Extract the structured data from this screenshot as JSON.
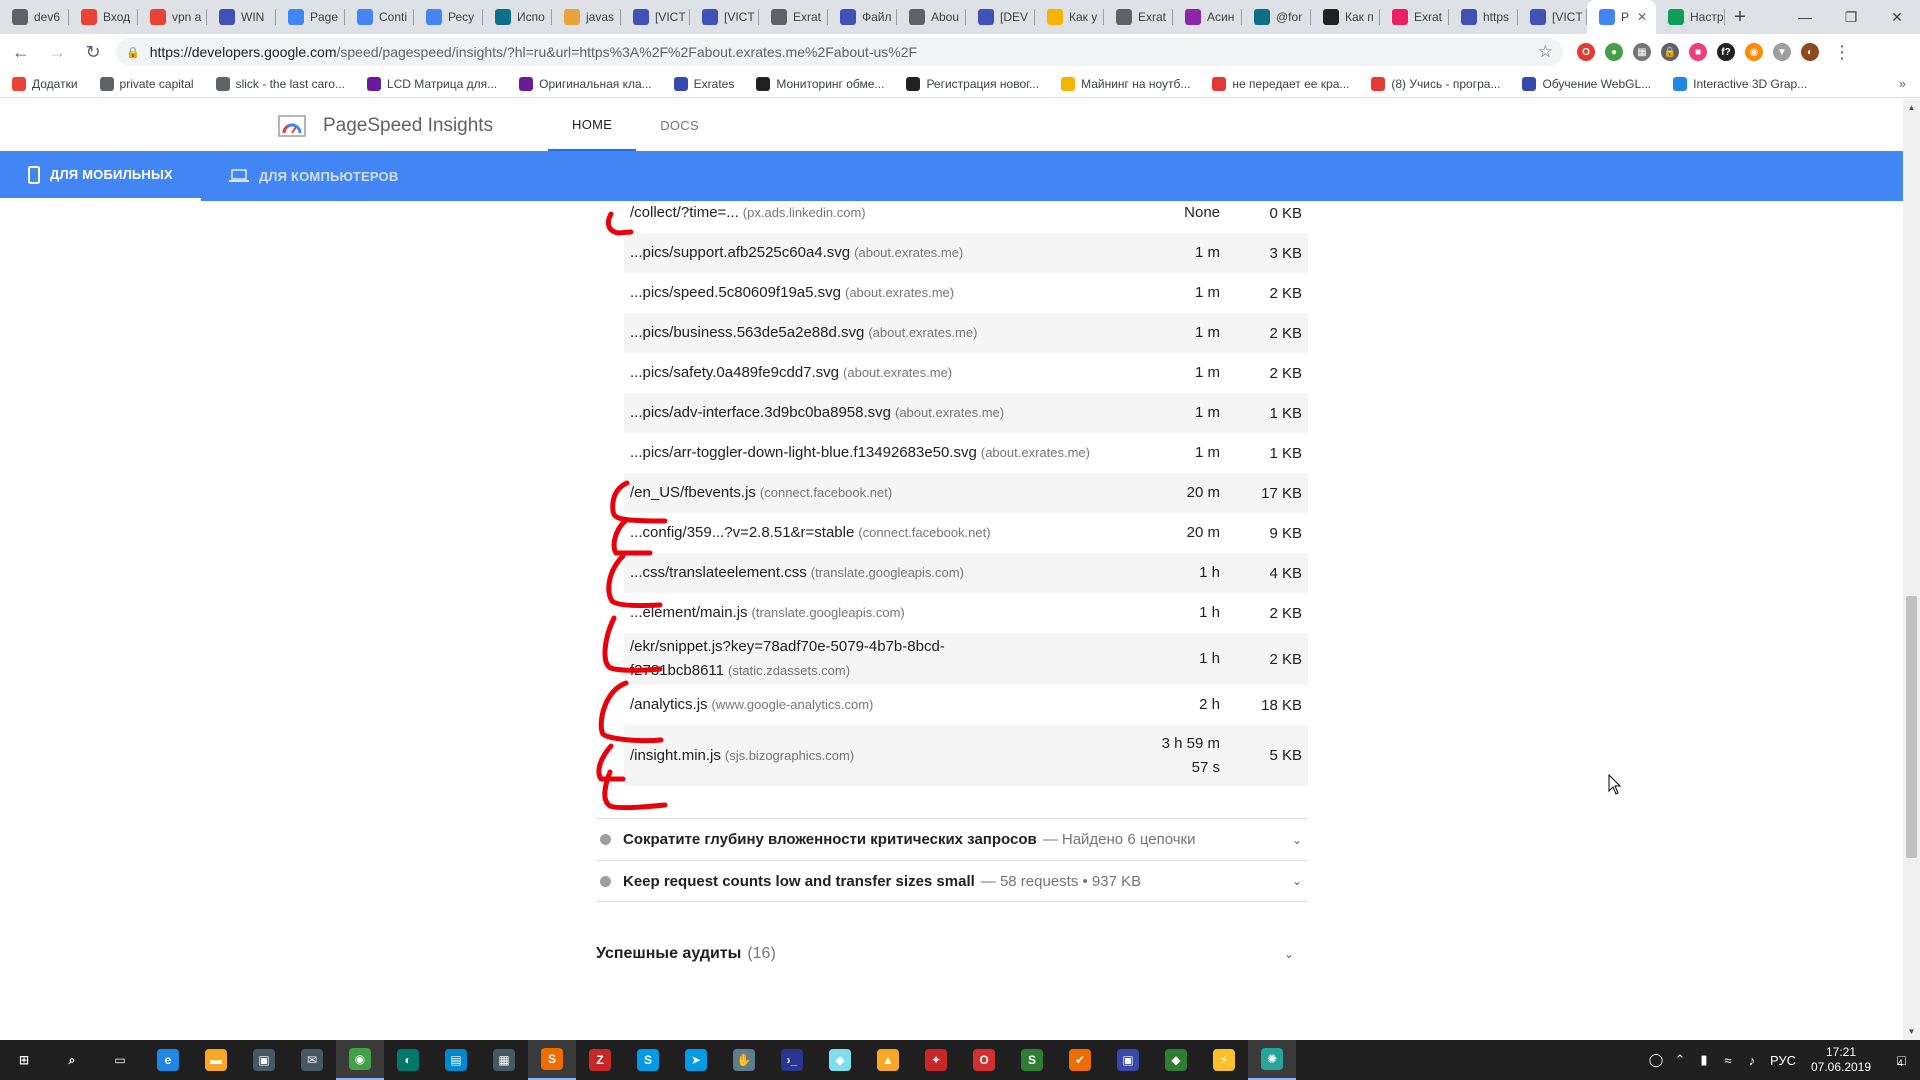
{
  "browser": {
    "tabs": [
      {
        "label": "dev6",
        "color": "#5f6368"
      },
      {
        "label": "Вход",
        "color": "#ea4335"
      },
      {
        "label": "vpn a",
        "color": "#ea4335"
      },
      {
        "label": "WIN",
        "color": "#3f51b5"
      },
      {
        "label": "Page",
        "color": "#4285f4"
      },
      {
        "label": "Conti",
        "color": "#4285f4"
      },
      {
        "label": "Ресу",
        "color": "#4285f4"
      },
      {
        "label": "Испо",
        "color": "#0d6e8a"
      },
      {
        "label": "javas",
        "color": "#e8a33d"
      },
      {
        "label": "[VICT",
        "color": "#3f51b5"
      },
      {
        "label": "[VICT",
        "color": "#3f51b5"
      },
      {
        "label": "Exrat",
        "color": "#5f6368"
      },
      {
        "label": "Файл",
        "color": "#3f51b5"
      },
      {
        "label": "Abou",
        "color": "#5f6368"
      },
      {
        "label": "[DEV",
        "color": "#3f51b5"
      },
      {
        "label": "Как у",
        "color": "#f4b400"
      },
      {
        "label": "Exrat",
        "color": "#5f6368"
      },
      {
        "label": "Асин",
        "color": "#8e24aa"
      },
      {
        "label": "@for",
        "color": "#0d6e8a"
      },
      {
        "label": "Как п",
        "color": "#212121"
      },
      {
        "label": "Exrat",
        "color": "#e91e63"
      },
      {
        "label": "https",
        "color": "#3f51b5"
      },
      {
        "label": "[VICT",
        "color": "#3f51b5"
      },
      {
        "label": "P",
        "color": "#4285f4",
        "active": true
      },
      {
        "label": "Настр",
        "color": "#0f9d58"
      }
    ],
    "new_tab": "+",
    "address": {
      "host": "https://developers.google.com",
      "rest": "/speed/pagespeed/insights/?hl=ru&url=https%3A%2F%2Fabout.exrates.me%2Fabout-us%2F"
    },
    "extensions": [
      {
        "label": "O",
        "color": "#e53935"
      },
      {
        "label": "●",
        "color": "#43a047"
      },
      {
        "label": "▦",
        "color": "#757575"
      },
      {
        "label": "🔒",
        "color": "#5f6368"
      },
      {
        "label": "■",
        "color": "#ec407a"
      },
      {
        "label": "f?",
        "color": "#212121"
      },
      {
        "label": "◉",
        "color": "#fb8c00"
      },
      {
        "label": "▼",
        "color": "#9e9e9e"
      },
      {
        "label": "◐",
        "color": "#8d4a1e"
      }
    ],
    "bookmarks": [
      {
        "label": "Додатки",
        "color": "#ea4335"
      },
      {
        "label": "private capital",
        "color": "#5f6368"
      },
      {
        "label": "slick - the last caro...",
        "color": "#5f6368"
      },
      {
        "label": "LCD Матрица для...",
        "color": "#6a1b9a"
      },
      {
        "label": "Оригинальная кла...",
        "color": "#6a1b9a"
      },
      {
        "label": "Exrates",
        "color": "#3949ab"
      },
      {
        "label": "Мониторинг обме...",
        "color": "#212121"
      },
      {
        "label": "Регистрация новог...",
        "color": "#212121"
      },
      {
        "label": "Майнинг на ноутб...",
        "color": "#f4b400"
      },
      {
        "label": "не передает ее кра...",
        "color": "#e53935"
      },
      {
        "label": "(8) Учись - програ...",
        "color": "#e53935"
      },
      {
        "label": "Обучение WebGL...",
        "color": "#3949ab"
      },
      {
        "label": "Interactive 3D Grap...",
        "color": "#1e88e5"
      }
    ],
    "bookmarks_more": "»"
  },
  "psi": {
    "title": "PageSpeed Insights",
    "nav": [
      "HOME",
      "DOCS"
    ],
    "device_tabs": [
      "ДЛЯ МОБИЛЬНЫХ",
      "ДЛЯ КОМПЬЮТЕРОВ"
    ],
    "cache_rows": [
      {
        "url": "/collect/?time=...",
        "host": "(px.ads.linkedin.com)",
        "ttl": "None",
        "size": "0 KB",
        "shaded": false
      },
      {
        "url": "...pics/support.afb2525c60a4.svg",
        "host": "(about.exrates.me)",
        "ttl": "1 m",
        "size": "3 KB",
        "shaded": true
      },
      {
        "url": "...pics/speed.5c80609f19a5.svg",
        "host": "(about.exrates.me)",
        "ttl": "1 m",
        "size": "2 KB",
        "shaded": false
      },
      {
        "url": "...pics/business.563de5a2e88d.svg",
        "host": "(about.exrates.me)",
        "ttl": "1 m",
        "size": "2 KB",
        "shaded": true
      },
      {
        "url": "...pics/safety.0a489fe9cdd7.svg",
        "host": "(about.exrates.me)",
        "ttl": "1 m",
        "size": "2 KB",
        "shaded": false
      },
      {
        "url": "...pics/adv-interface.3d9bc0ba8958.svg",
        "host": "(about.exrates.me)",
        "ttl": "1 m",
        "size": "1 KB",
        "shaded": true
      },
      {
        "url": "...pics/arr-toggler-down-light-blue.f13492683e50.svg",
        "host": "(about.exrates.me)",
        "ttl": "1 m",
        "size": "1 KB",
        "shaded": false
      },
      {
        "url": "/en_US/fbevents.js",
        "host": "(connect.facebook.net)",
        "ttl": "20 m",
        "size": "17 KB",
        "shaded": true
      },
      {
        "url": "...config/359...?v=2.8.51&r=stable",
        "host": "(connect.facebook.net)",
        "ttl": "20 m",
        "size": "9 KB",
        "shaded": false
      },
      {
        "url": "...css/translateelement.css",
        "host": "(translate.googleapis.com)",
        "ttl": "1 h",
        "size": "4 KB",
        "shaded": true
      },
      {
        "url": "...element/main.js",
        "host": "(translate.googleapis.com)",
        "ttl": "1 h",
        "size": "2 KB",
        "shaded": false
      },
      {
        "url": "/ekr/snippet.js?key=78adf70e-5079-4b7b-8bcd-",
        "url2": "f2781bcb8611",
        "host": "(static.zdassets.com)",
        "ttl": "1 h",
        "size": "2 KB",
        "shaded": true
      },
      {
        "url": "/analytics.js",
        "host": "(www.google-analytics.com)",
        "ttl": "2 h",
        "size": "18 KB",
        "shaded": false
      },
      {
        "url": "/insight.min.js",
        "host": "(sjs.bizographics.com)",
        "ttl": "3 h 59 m",
        "ttl2": "57 s",
        "size": "5 KB",
        "shaded": true
      }
    ],
    "audits": [
      {
        "title": "Сократите глубину вложенности критических запросов",
        "extra": "— Найдено 6 цепочки"
      },
      {
        "title": "Keep request counts low and transfer sizes small",
        "extra": "— 58 requests • 937 KB"
      }
    ],
    "passed": {
      "label": "Успешные аудиты",
      "count": "(16)"
    }
  },
  "taskbar": {
    "apps": [
      {
        "name": "start",
        "label": "⊞",
        "color": "#1f1f1f"
      },
      {
        "name": "search",
        "label": "⌕",
        "color": "#1f1f1f"
      },
      {
        "name": "task-view",
        "label": "▭",
        "color": "#1f1f1f"
      },
      {
        "name": "edge",
        "label": "e",
        "color": "#1e88e5"
      },
      {
        "name": "explorer",
        "label": "▬",
        "color": "#f9a825"
      },
      {
        "name": "store",
        "label": "▣",
        "color": "#455a64"
      },
      {
        "name": "mail",
        "label": "✉",
        "color": "#455a64"
      },
      {
        "name": "chrome",
        "label": "◉",
        "color": "#43a047",
        "running": true
      },
      {
        "name": "app-dark",
        "label": "◐",
        "color": "#00796b"
      },
      {
        "name": "app-win",
        "label": "▤",
        "color": "#0288d1"
      },
      {
        "name": "calculator",
        "label": "▦",
        "color": "#455a64"
      },
      {
        "name": "sublime",
        "label": "S",
        "color": "#ef6c00",
        "running": true
      },
      {
        "name": "filezilla",
        "label": "Z",
        "color": "#c62828"
      },
      {
        "name": "skype",
        "label": "S",
        "color": "#039be5"
      },
      {
        "name": "telegram",
        "label": "➤",
        "color": "#039be5"
      },
      {
        "name": "app-hand",
        "label": "✋",
        "color": "#607d8b"
      },
      {
        "name": "powershell",
        "label": "›_",
        "color": "#283593"
      },
      {
        "name": "app-feather",
        "label": "◆",
        "color": "#80deea"
      },
      {
        "name": "app-triangle",
        "label": "▲",
        "color": "#f9a825"
      },
      {
        "name": "app-red",
        "label": "✦",
        "color": "#c62828"
      },
      {
        "name": "opera",
        "label": "O",
        "color": "#d32f2f"
      },
      {
        "name": "app-green",
        "label": "S",
        "color": "#2e7d32"
      },
      {
        "name": "app-check",
        "label": "✔",
        "color": "#ef6c00"
      },
      {
        "name": "app-monitor",
        "label": "▣",
        "color": "#3949ab"
      },
      {
        "name": "app-git",
        "label": "◆",
        "color": "#2e7d32"
      },
      {
        "name": "app-bolt",
        "label": "⚡",
        "color": "#fbc02d"
      },
      {
        "name": "app-globe",
        "label": "✺",
        "color": "#26a69a",
        "running": true
      }
    ],
    "tray": {
      "lang": "РУС",
      "time": "17:21",
      "date": "07.06.2019",
      "notifications": "4"
    }
  }
}
